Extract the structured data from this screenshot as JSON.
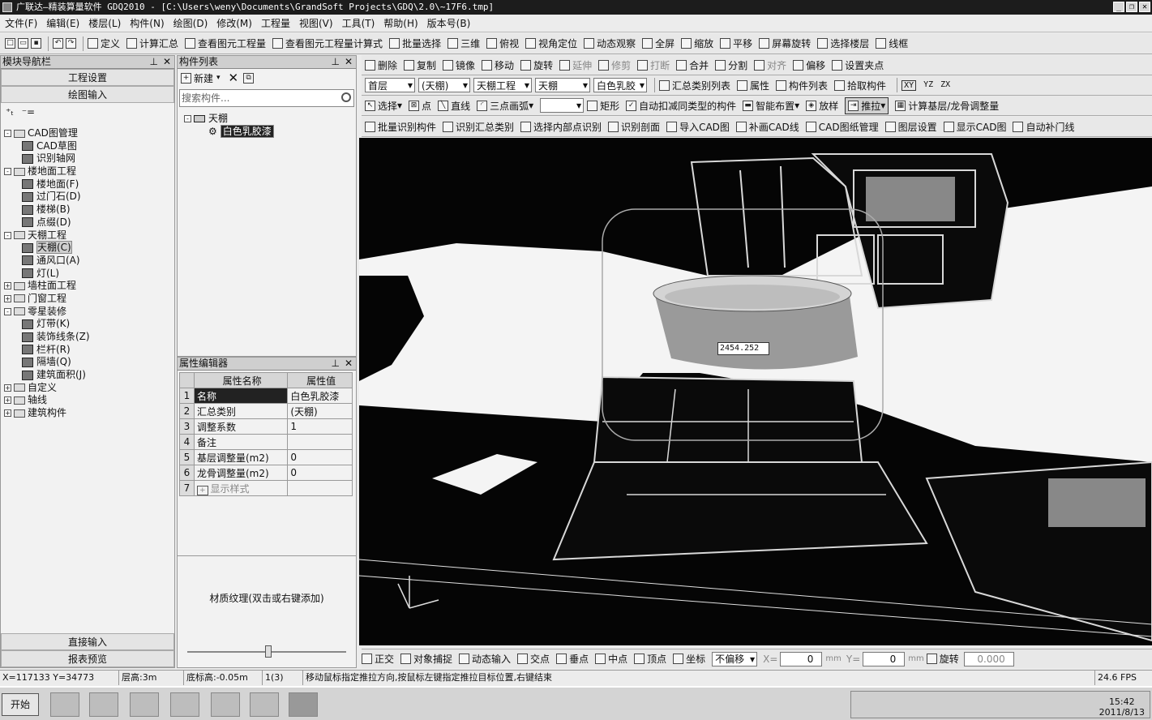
{
  "window": {
    "title": "广联达—精装算量软件 GDQ2010 - [C:\\Users\\weny\\Documents\\GrandSoft Projects\\GDQ\\2.0\\~17F6.tmp]"
  },
  "menu": [
    "文件(F)",
    "编辑(E)",
    "楼层(L)",
    "构件(N)",
    "绘图(D)",
    "修改(M)",
    "工程量",
    "视图(V)",
    "工具(T)",
    "帮助(H)",
    "版本号(B)"
  ],
  "toolbar": [
    "定义",
    "计算汇总",
    "查看图元工程量",
    "查看图元工程量计算式",
    "批量选择",
    "三维",
    "俯视",
    "视角定位",
    "动态观察",
    "全屏",
    "缩放",
    "平移",
    "屏幕旋转",
    "选择楼层",
    "线框"
  ],
  "nav": {
    "title": "模块导航栏",
    "project_settings": "工程设置",
    "drawing_input": "绘图输入",
    "direct_input": "直接输入",
    "report_preview": "报表预览",
    "tree": [
      {
        "label": "CAD图管理",
        "level": 0,
        "expand": "-"
      },
      {
        "label": "CAD草图",
        "level": 1
      },
      {
        "label": "识别轴网",
        "level": 1
      },
      {
        "label": "楼地面工程",
        "level": 0,
        "expand": "-"
      },
      {
        "label": "楼地面(F)",
        "level": 1
      },
      {
        "label": "过门石(D)",
        "level": 1
      },
      {
        "label": "楼梯(B)",
        "level": 1
      },
      {
        "label": "点缀(D)",
        "level": 1
      },
      {
        "label": "天棚工程",
        "level": 0,
        "expand": "-"
      },
      {
        "label": "天棚(C)",
        "level": 1,
        "selected": true
      },
      {
        "label": "通风口(A)",
        "level": 1
      },
      {
        "label": "灯(L)",
        "level": 1
      },
      {
        "label": "墙柱面工程",
        "level": 0,
        "expand": "+"
      },
      {
        "label": "门窗工程",
        "level": 0,
        "expand": "+"
      },
      {
        "label": "零星装修",
        "level": 0,
        "expand": "-"
      },
      {
        "label": "灯带(K)",
        "level": 1
      },
      {
        "label": "装饰线条(Z)",
        "level": 1
      },
      {
        "label": "栏杆(R)",
        "level": 1
      },
      {
        "label": "隔墙(Q)",
        "level": 1
      },
      {
        "label": "建筑面积(J)",
        "level": 1
      },
      {
        "label": "自定义",
        "level": 0,
        "expand": "+"
      },
      {
        "label": "轴线",
        "level": 0,
        "expand": "+"
      },
      {
        "label": "建筑构件",
        "level": 0,
        "expand": "+"
      }
    ]
  },
  "component_list": {
    "title": "构件列表",
    "new_label": "新建",
    "search_placeholder": "搜索构件...",
    "root": "天棚",
    "item": "白色乳胶漆"
  },
  "property_editor": {
    "title": "属性编辑器",
    "col_name": "属性名称",
    "col_value": "属性值",
    "rows": [
      {
        "n": "1",
        "name": "名称",
        "value": "白色乳胶漆"
      },
      {
        "n": "2",
        "name": "汇总类别",
        "value": "(天棚)"
      },
      {
        "n": "3",
        "name": "调整系数",
        "value": "1"
      },
      {
        "n": "4",
        "name": "备注",
        "value": ""
      },
      {
        "n": "5",
        "name": "基层调整量(m2)",
        "value": "0"
      },
      {
        "n": "6",
        "name": "龙骨调整量(m2)",
        "value": "0"
      },
      {
        "n": "7",
        "name": "显示样式",
        "value": ""
      }
    ],
    "texture_hint": "材质纹理(双击或右键添加)"
  },
  "edit_toolbar": [
    "删除",
    "复制",
    "镜像",
    "移动",
    "旋转",
    "延伸",
    "修剪",
    "打断",
    "合并",
    "分割",
    "对齐",
    "偏移",
    "设置夹点"
  ],
  "floor_toolbar": {
    "floor": "首层",
    "category": "(天棚)",
    "project": "天棚工程",
    "type": "天棚",
    "component": "白色乳胶",
    "buttons": [
      "汇总类别列表",
      "属性",
      "构件列表",
      "拾取构件"
    ],
    "axes": [
      "XY",
      "YZ",
      "ZX"
    ]
  },
  "draw_toolbar": [
    "选择",
    "点",
    "直线",
    "三点画弧",
    "矩形",
    "自动扣减同类型的构件",
    "智能布置",
    "放样",
    "推拉",
    "计算基层/龙骨调整量"
  ],
  "cad_toolbar": [
    "批量识别构件",
    "识别汇总类别",
    "选择内部点识别",
    "识别剖面",
    "导入CAD图",
    "补画CAD线",
    "CAD图纸管理",
    "图层设置",
    "显示CAD图",
    "自动补门线"
  ],
  "canvas": {
    "dim_input": "2454.252"
  },
  "snap_bar": {
    "items": [
      "正交",
      "对象捕捉",
      "动态输入",
      "交点",
      "垂点",
      "中点",
      "顶点",
      "坐标"
    ],
    "offset": "不偏移",
    "x_label": "X=",
    "x_value": "0",
    "y_label": "Y=",
    "y_value": "0",
    "mm": "mm",
    "rotate": "旋转",
    "angle": "0.000"
  },
  "status": {
    "coords": "X=117133 Y=34773",
    "floor_height": "层高:3m",
    "base_height": "底标高:-0.05m",
    "count": "1(3)",
    "hint": "移动鼠标指定推拉方向,按鼠标左键指定推拉目标位置,右键结束",
    "fps": "24.6 FPS"
  },
  "taskbar": {
    "start": "开始",
    "time": "15:42",
    "date": "2011/8/13"
  }
}
